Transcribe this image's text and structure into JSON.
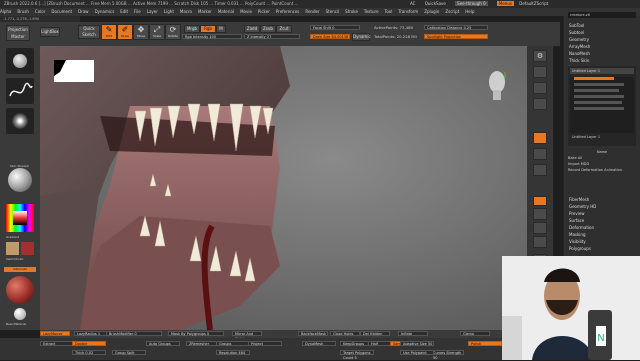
{
  "titlebar": {
    "text": "ZBrush 2022.0.6 [...] [ZBrush Document ... Free Mem 5.00GB ... Active Mem 7199 ... Scratch Disk 105 ... Timer 0.031 ... PolyCount ... PointCount ...",
    "right_items": [
      "AC",
      "QuickSave",
      "See-through 0",
      "Menus",
      "DefaultZScript"
    ]
  },
  "menubar": {
    "items": [
      "Alpha",
      "Brush",
      "Color",
      "Document",
      "Draw",
      "Dynamics",
      "Edit",
      "File",
      "Layer",
      "Light",
      "Macro",
      "Marker",
      "Material",
      "Movie",
      "Picker",
      "Preferences",
      "Render",
      "Stencil",
      "Stroke",
      "Texture",
      "Tool",
      "Transform",
      "Zplugin",
      "Zscript",
      "Help"
    ]
  },
  "coords": "-1.771,-0.276,-1.690",
  "top_shelf": {
    "projection_master": "Projection Master",
    "lightbox": "LightBox",
    "quick_sketch": "Quick Sketch",
    "edit": "Edit",
    "draw": "Draw",
    "move": "Move",
    "scale": "Scale",
    "rotate": "Rotate",
    "mrgb": "Mrgb",
    "rgb": "Rgb",
    "m": "M",
    "zadd": "Zadd",
    "zsub": "Zsub",
    "zcut": "Zcut",
    "rgb_intensity": "Rgb Intensity 100",
    "z_intensity": "Z Intensity 27",
    "focal_shift": "Focal Shift 0",
    "draw_size": "Draw Size 64.00136",
    "dynamic": "Dynamic",
    "active_points": "ActivePoints: 73,489",
    "total_points": "TotalPoints: 20.228 Mil",
    "calibration": "Calibration Distance 0.25",
    "spotlight": "Spotlight Projection"
  },
  "left_shelf": {
    "standard_label": "Standard",
    "freehand_label": "FreeHand",
    "spray_label": "Spray",
    "material_label": "Skin Shade4",
    "gradient_label": "Gradient",
    "switch_color": "SwitchColor",
    "alternate": "Alternate",
    "basic_material": "BasicMaterial"
  },
  "right_panel": {
    "header": "SubTool",
    "search_placeholder": "creature.ztl",
    "items": [
      "Subtool",
      "Geometry",
      "ArrayMesh",
      "NanoMesh",
      "Thick Skin",
      "Layers"
    ],
    "layer_name": "Untitled Layer 1",
    "layer_name_2": "Untitled Layer 1",
    "layers_controls": [
      "Name",
      "Bake All",
      "Import MDD",
      "Record Deformation Animation"
    ],
    "items_after": [
      "FiberMesh",
      "Geometry HD",
      "Preview",
      "Surface",
      "Deformation",
      "Masking",
      "Visibility",
      "Polygroups"
    ]
  },
  "bottom_bar": {
    "items": [
      "LazyMouse",
      "LazyRadius 1",
      "BrushModifier 0",
      "Mask By Polygroups 0",
      "Mirror And Weld",
      "BackfaceMask",
      "Close Holes",
      "Del Hidden",
      "Inflate",
      "Gizmo"
    ]
  },
  "bottom_shelf": {
    "items": [
      "Extract",
      "Double",
      "Thick 0.02",
      "Group Split",
      "Auto Groups",
      "ZRemesher",
      "Groups",
      "Project",
      "Resolution 464",
      "DynaMesh",
      "KeepGroups",
      "Half",
      "Same",
      "Target Polygons Count 5",
      "Adaptive Size 50",
      "Curves Strength 50",
      "Use Polypaint",
      "Polish"
    ]
  },
  "colors": {
    "accent": "#e8771f",
    "panel_bg": "#2f2f2f",
    "shelf_bg": "#3a3a3a"
  },
  "icons": [
    "move-icon",
    "scale-icon",
    "rotate-icon",
    "draw-icon",
    "edit-icon",
    "head-icon",
    "gear-icon",
    "play-icon"
  ]
}
